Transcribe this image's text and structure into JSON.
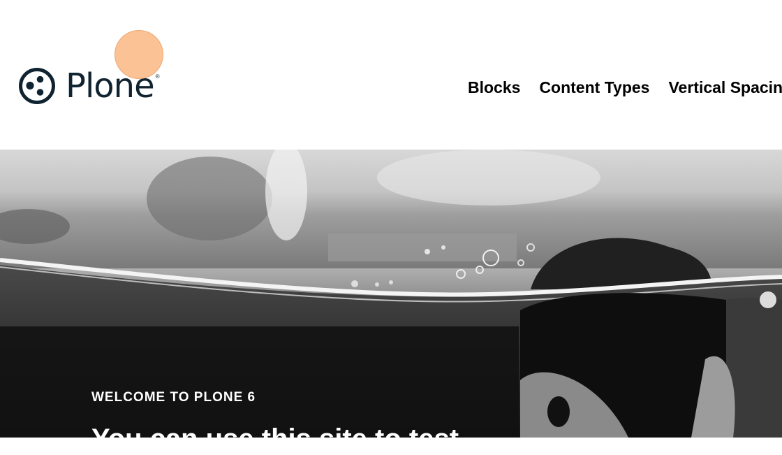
{
  "header": {
    "logo": {
      "text": "Plone",
      "registered_mark": "®",
      "icon": "plone-logo-icon"
    },
    "nav": {
      "items": [
        "Blocks",
        "Content Types",
        "Vertical Spacing"
      ]
    }
  },
  "hero": {
    "image": "water-surface-photo",
    "eyebrow": "WELCOME TO PLONE 6",
    "title": "You can use this site to test"
  },
  "colors": {
    "logo": "#102331",
    "nav_text": "#000000",
    "panel": "#111111",
    "hero_text": "#ffffff",
    "cursor_highlight": "#faaa6e"
  }
}
